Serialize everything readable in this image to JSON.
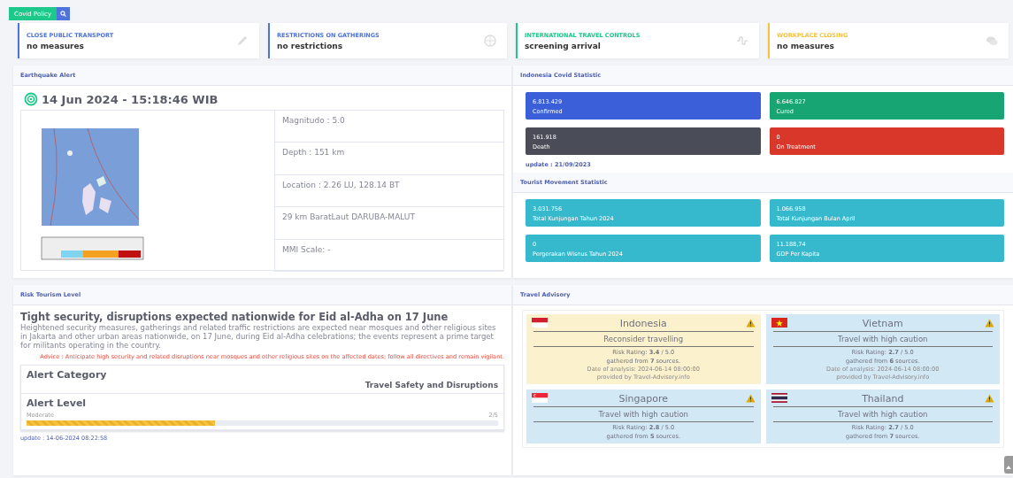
{
  "toolbar": {
    "policy_button": "Covid Policy"
  },
  "policies": [
    {
      "title": "CLOSE PUBLIC TRANSPORT",
      "value": "no measures",
      "color": "#4e73df",
      "kind": "pencil"
    },
    {
      "title": "RESTRICTIONS ON GATHERINGS",
      "value": "no restrictions",
      "color": "#4e73df",
      "kind": "globe"
    },
    {
      "title": "INTERNATIONAL TRAVEL CONTROLS",
      "value": "screening arrival",
      "color": "#1cc88a",
      "kind": "pulse"
    },
    {
      "title": "WORKPLACE CLOSING",
      "value": "no measures",
      "color": "#f6c23e",
      "kind": "chat"
    }
  ],
  "earthquake": {
    "title": "Earthquake Alert",
    "datetime": "14 Jun 2024 - 15:18:46 WIB",
    "details": [
      "Magnitudo : 5.0",
      "Depth : 151 km",
      "Location : 2.26 LU, 128.14 BT",
      "29 km BaratLaut DARUBA-MALUT",
      "MMI Scale: -"
    ]
  },
  "covid": {
    "title": "Indonesia Covid Statistic",
    "stats": [
      {
        "value": "6.813.429",
        "label": "Confirmed",
        "color": "#3a5fd8"
      },
      {
        "value": "6.646.827",
        "label": "Cured",
        "color": "#17a673"
      },
      {
        "value": "161.918",
        "label": "Death",
        "color": "#4a4d57"
      },
      {
        "value": "0",
        "label": "On Treatment",
        "color": "#d9372a"
      }
    ],
    "update": "update : 21/09/2023"
  },
  "tourism": {
    "title": "Tourist Movement Statistic",
    "stats": [
      {
        "value": "3.031.756",
        "label": "Total Kunjungan Tahun 2024"
      },
      {
        "value": "1.066.958",
        "label": "Total Kunjungan Bulan April"
      },
      {
        "value": "0",
        "label": "Pergerakan Wisnus Tahun 2024"
      },
      {
        "value": "11.188,74",
        "label": "GDP Per Kapita"
      }
    ]
  },
  "risk": {
    "title": "Risk Tourism Level",
    "headline": "Tight security, disruptions expected nationwide for Eid al-Adha on 17 June",
    "body": "Heightened security measures, gatherings and related traffic restrictions are expected near mosques and other religious sites in Jakarta and other urban areas nationwide, on 17 June, during Eid al-Adha celebrations; the events represent a prime target for militants operating in the country.",
    "advice": "Advice : Anticipate high security and related disruptions near mosques and other religious sites on the affected dates; follow all directives and remain vigilant.",
    "category_label": "Alert Category",
    "category": "Travel Safety and Disruptions",
    "level_label": "Alert Level",
    "level_name": "Moderate",
    "level_reading": "2/5",
    "level": 0.4,
    "update": "update : 14-06-2024 08:22:58"
  },
  "advisory": {
    "title": "Travel Advisory",
    "countries": [
      {
        "name": "Indonesia",
        "kind": "two-band",
        "color": "#fcf1cd",
        "status": "Reconsider travelling",
        "rating": "Risk Rating: **3.4** / 5.0",
        "sources": "gathered from **7** sources.",
        "date": "Date of analysis: 2024-06-14 08:00:00",
        "provider": "provided by Travel-Advisory.info"
      },
      {
        "name": "Vietnam",
        "kind": "star",
        "color": "#d3e8f5",
        "status": "Travel with high caution",
        "rating": "Risk Rating: **2.7** / 5.0",
        "sources": "gathered from **6** sources.",
        "date": "Date of analysis: 2024-06-14 08:00:00",
        "provider": "provided by Travel-Advisory.info"
      },
      {
        "name": "Singapore",
        "kind": "crescent",
        "color": "#d3e8f5",
        "status": "Travel with high caution",
        "rating": "Risk Rating: **2.8** / 5.0",
        "sources": "gathered from **5** sources."
      },
      {
        "name": "Thailand",
        "kind": "five-stripe",
        "color": "#d3e8f5",
        "status": "Travel with high caution",
        "rating": "Risk Rating: **2.7** / 5.0",
        "sources": "gathered from **7** sources."
      }
    ]
  }
}
